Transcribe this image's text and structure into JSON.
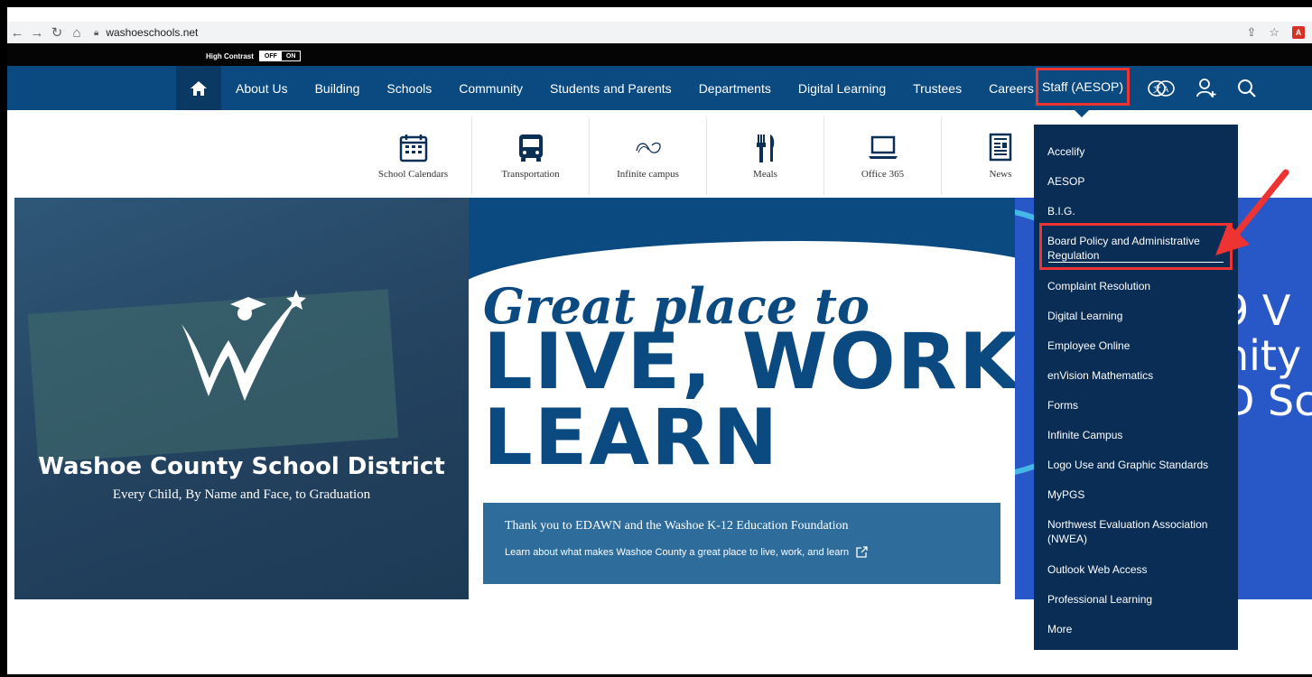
{
  "browser": {
    "url": "washoeschools.net"
  },
  "high_contrast": {
    "label": "High Contrast",
    "off": "OFF",
    "on": "ON"
  },
  "nav": {
    "items": [
      "About Us",
      "Building",
      "Schools",
      "Community",
      "Students and Parents",
      "Departments",
      "Digital Learning",
      "Trustees",
      "Careers"
    ],
    "staff": "Staff (AESOP)"
  },
  "quick_links": [
    "School Calendars",
    "Transportation",
    "Infinite campus",
    "Meals",
    "Office 365",
    "News"
  ],
  "hero": {
    "district": "Washoe County School District",
    "tagline": "Every Child, By Name and Face, to Graduation",
    "headline": "Great place to",
    "big_1": "LIVE, WORK,",
    "big_2": "LEARN",
    "thanks_title": "Thank you to EDAWN and the Washoe K-12 Education Foundation",
    "thanks_link": "Learn about what makes Washoe County a great place to live, work, and learn",
    "partial_1": "9 V",
    "partial_2": "nity",
    "partial_3": "D Sc"
  },
  "dropdown": {
    "items": [
      "Accelify",
      "AESOP",
      "B.I.G.",
      "Board Policy and Administrative Regulation",
      "Complaint Resolution",
      "Digital Learning",
      "Employee Online",
      "enVision Mathematics",
      "Forms",
      "Infinite Campus",
      "Logo Use and Graphic Standards",
      "MyPGS",
      "Northwest Evaluation Association (NWEA)",
      "Outlook Web Access",
      "Professional Learning",
      "More"
    ]
  },
  "colors": {
    "nav": "#0b4a80",
    "dropdown": "#0a2d55",
    "highlight": "#e33333"
  }
}
